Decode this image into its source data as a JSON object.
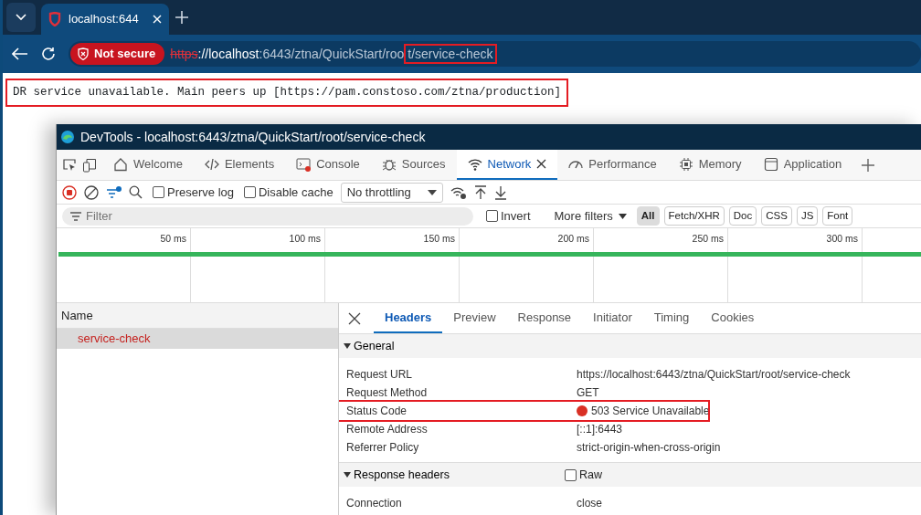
{
  "browser": {
    "tabs": [
      {
        "title": "localhost:644",
        "selected": true
      }
    ],
    "security_label": "Not secure",
    "url_parts": [
      {
        "kind": "scheme",
        "text": "https",
        "highlighted": false
      },
      {
        "kind": "host",
        "text": "://localhost",
        "highlighted": false
      },
      {
        "kind": "path",
        "text": ":6443/ztna/QuickStart/roo",
        "highlighted": false
      },
      {
        "kind": "path",
        "text": "t/service-check",
        "highlighted": true
      }
    ]
  },
  "page": {
    "message": "DR service unavailable. Main peers up [https://pam.constoso.com/ztna/production]",
    "highlighted": true
  },
  "devtools": {
    "title": "DevTools - localhost:6443/ztna/QuickStart/root/service-check",
    "tabs": [
      {
        "label": "Welcome",
        "selected": false
      },
      {
        "label": "Elements",
        "selected": false
      },
      {
        "label": "Console",
        "selected": false
      },
      {
        "label": "Sources",
        "selected": false
      },
      {
        "label": "Network",
        "selected": true
      },
      {
        "label": "Performance",
        "selected": false
      },
      {
        "label": "Memory",
        "selected": false
      },
      {
        "label": "Application",
        "selected": false
      }
    ],
    "toolbar": {
      "checkboxes": [
        {
          "label": "Preserve log",
          "checked": false
        },
        {
          "label": "Disable cache",
          "checked": false
        }
      ],
      "throttling": "No throttling"
    },
    "filter": {
      "placeholder": "Filter",
      "invert": {
        "label": "Invert",
        "checked": false
      },
      "more_filters": "More filters",
      "types": [
        {
          "label": "All",
          "selected": true
        },
        {
          "label": "Fetch/XHR",
          "selected": false
        },
        {
          "label": "Doc",
          "selected": false
        },
        {
          "label": "CSS",
          "selected": false
        },
        {
          "label": "JS",
          "selected": false
        },
        {
          "label": "Font",
          "selected": false
        }
      ]
    },
    "timeline": {
      "ticks": [
        "50 ms",
        "100 ms",
        "150 ms",
        "200 ms",
        "250 ms",
        "300 ms"
      ]
    },
    "requests": {
      "column": "Name",
      "rows": [
        {
          "name": "service-check",
          "selected": true,
          "failed": true
        }
      ]
    },
    "details": {
      "tabs": [
        {
          "label": "Headers",
          "selected": true
        },
        {
          "label": "Preview",
          "selected": false
        },
        {
          "label": "Response",
          "selected": false
        },
        {
          "label": "Initiator",
          "selected": false
        },
        {
          "label": "Timing",
          "selected": false
        },
        {
          "label": "Cookies",
          "selected": false
        }
      ],
      "sections": [
        {
          "title": "General",
          "expanded": true,
          "rows": [
            {
              "kind": "text",
              "key": "Request URL",
              "value": "https://localhost:6443/ztna/QuickStart/root/service-check",
              "highlighted": false
            },
            {
              "kind": "text",
              "key": "Request Method",
              "value": "GET",
              "highlighted": false
            },
            {
              "kind": "status",
              "key": "Status Code",
              "value": "503 Service Unavailable",
              "highlighted": true
            },
            {
              "kind": "text",
              "key": "Remote Address",
              "value": "[::1]:6443",
              "highlighted": false
            },
            {
              "kind": "text",
              "key": "Referrer Policy",
              "value": "strict-origin-when-cross-origin",
              "highlighted": false
            }
          ]
        },
        {
          "title": "Response headers",
          "expanded": true,
          "raw": {
            "label": "Raw",
            "checked": false
          },
          "rows": [
            {
              "kind": "text",
              "key": "Connection",
              "value": "close",
              "highlighted": false
            }
          ]
        }
      ]
    }
  }
}
